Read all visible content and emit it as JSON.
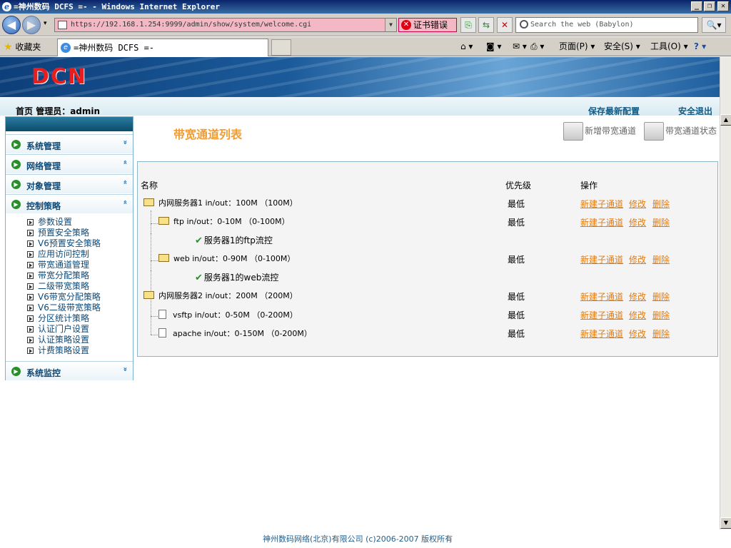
{
  "window": {
    "title": "=神州数码 DCFS =- - Windows Internet Explorer",
    "ie_glyph": "e",
    "controls": {
      "minimize": "_",
      "restore": "❐",
      "close": "✕"
    }
  },
  "browser": {
    "back": "◀",
    "forward": "▶",
    "recent": "▾",
    "url": "https://192.168.1.254:9999/admin/show/system/welcome.cgi",
    "cert_error": "证书错误",
    "search_placeholder": "Search the web (Babylon)",
    "favorites": "收藏夹",
    "tab_title": "=神州数码 DCFS =-",
    "commands": {
      "page": "页面(P)",
      "safety": "安全(S)",
      "tools": "工具(O)",
      "help": "?"
    }
  },
  "header": {
    "logo": "DCN",
    "home": "首页",
    "admin_label": "管理员：admin",
    "save_config": "保存最新配置",
    "logout": "安全退出"
  },
  "sidebar": {
    "menus": [
      {
        "label": "系统管理",
        "chevron": "»",
        "expanded": false
      },
      {
        "label": "网络管理",
        "chevron": "«",
        "expanded": false
      },
      {
        "label": "对象管理",
        "chevron": "«",
        "expanded": false
      },
      {
        "label": "控制策略",
        "chevron": "«",
        "expanded": true
      },
      {
        "label": "系统监控",
        "chevron": "»",
        "expanded": false
      }
    ],
    "sub_items": [
      "参数设置",
      "预置安全策略",
      "V6预置安全策略",
      "应用访问控制",
      "带宽通道管理",
      "带宽分配策略",
      "二级带宽策略",
      "V6带宽分配策略",
      "V6二级带宽策略",
      "分区统计策略",
      "认证门户设置",
      "认证策略设置",
      "计费策略设置"
    ]
  },
  "content": {
    "title": "带宽通道列表",
    "actions": {
      "add": "新增带宽通道",
      "status": "带宽通道状态"
    },
    "columns": {
      "name": "名称",
      "priority": "优先级",
      "ops": "操作"
    },
    "rows": [
      {
        "name": "内网服务器1 in/out：100M （100M）",
        "priority": "最低",
        "icon": "folder",
        "level": 0
      },
      {
        "name": "ftp in/out：0-10M （0-100M）",
        "priority": "最低",
        "icon": "folder",
        "level": 1
      },
      {
        "name": "服务器1的ftp流控",
        "priority": "",
        "icon": "check",
        "level": 2
      },
      {
        "name": "web in/out：0-90M （0-100M）",
        "priority": "最低",
        "icon": "folder",
        "level": 1
      },
      {
        "name": "服务器1的web流控",
        "priority": "",
        "icon": "check",
        "level": 2
      },
      {
        "name": "内网服务器2 in/out：200M （200M）",
        "priority": "最低",
        "icon": "folder",
        "level": 0
      },
      {
        "name": "vsftp in/out：0-50M （0-200M）",
        "priority": "最低",
        "icon": "doc",
        "level": 1
      },
      {
        "name": "apache in/out：0-150M （0-200M）",
        "priority": "最低",
        "icon": "doc",
        "level": 1
      }
    ],
    "ops": {
      "new_sub": "新建子通道",
      "edit": "修改",
      "delete": "删除"
    }
  },
  "footer": "神州数码网络(北京)有限公司 (c)2006-2007 版权所有",
  "colors": {
    "accent_orange": "#f09d34",
    "link_orange": "#e07d14",
    "nav_blue": "#135b84",
    "check_green": "#1a9a1a"
  }
}
